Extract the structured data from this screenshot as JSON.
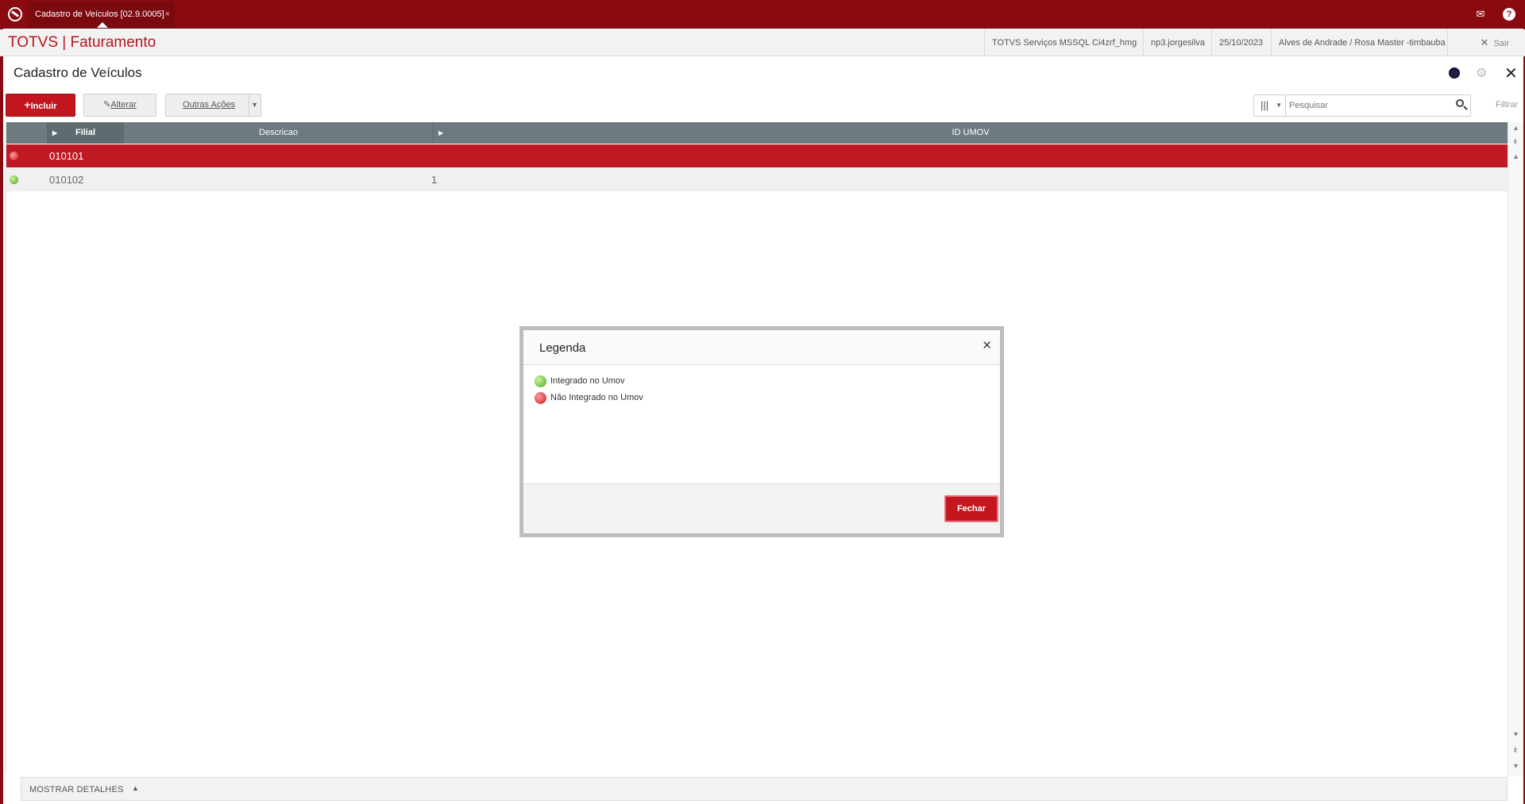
{
  "topbar": {
    "tab_label": "Cadastro de Veículos [02.9.0005]",
    "tab_close": "×",
    "mail_icon": "mail-icon",
    "help_icon": "?"
  },
  "header": {
    "app_title": "TOTVS | Faturamento",
    "environment": "TOTVS Serviços MSSQL Ci4zrf_hmg",
    "user": "np3.jorgesilva",
    "date": "25/10/2023",
    "company": "Alves de Andrade / Rosa Master -timbauba",
    "logout_label": "Sair"
  },
  "page": {
    "title": "Cadastro de Veículos"
  },
  "toolbar": {
    "incluir_label": "Incluir",
    "alterar_label": "Alterar",
    "outras_label": "Outras Ações",
    "search_placeholder": "Pesquisar",
    "filter_label": "Filtrar"
  },
  "grid": {
    "columns": [
      "",
      "Filial",
      "Descricao",
      "ID UMOV"
    ],
    "rows": [
      {
        "status": "red",
        "filial": "010101",
        "descricao": "",
        "id_umov": ""
      },
      {
        "status": "green",
        "filial": "010102",
        "descricao": "",
        "id_umov": "1"
      }
    ]
  },
  "footer": {
    "details_label": "MOSTRAR DETALHES"
  },
  "modal": {
    "title": "Legenda",
    "items": [
      {
        "color": "green",
        "label": "Integrado no Umov"
      },
      {
        "color": "red",
        "label": "Não Integrado no Umov"
      }
    ],
    "close_button": "Fechar"
  },
  "colors": {
    "brand": "#8a0a10",
    "accent": "#c4161f",
    "grid_header": "#6d7b80",
    "selected_row": "#bf1a23"
  }
}
